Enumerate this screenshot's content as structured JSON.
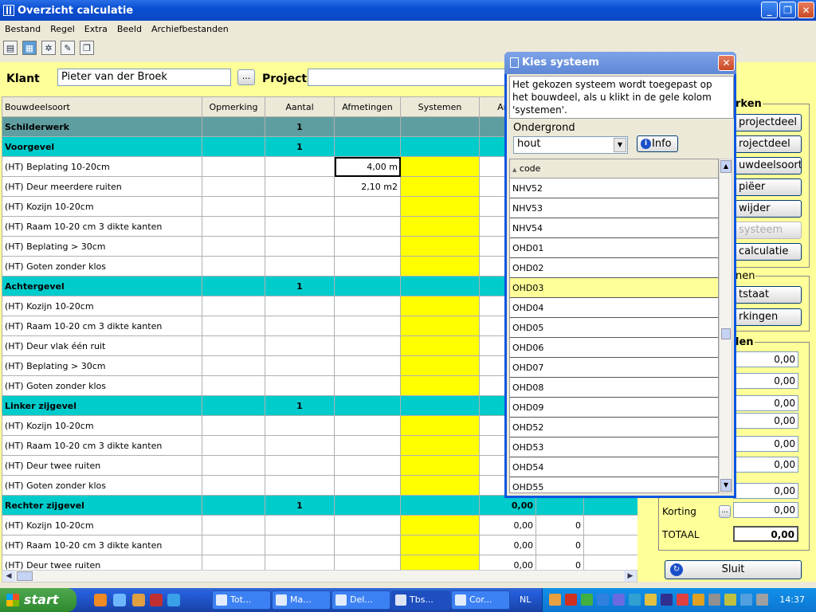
{
  "window": {
    "title": "Overzicht calculatie"
  },
  "menu": [
    "Bestand",
    "Regel",
    "Extra",
    "Beeld",
    "Archiefbestanden"
  ],
  "header": {
    "klant_label": "Klant",
    "klant_value": "Pieter van der Broek",
    "dots": "...",
    "project_label": "Project",
    "project_value": ""
  },
  "grid": {
    "columns": [
      "Bouwdeelsoort",
      "Opmerking",
      "Aantal",
      "Afmetingen",
      "Systemen",
      "Arbe"
    ],
    "rows": [
      {
        "type": "sec-dark",
        "name": "Schilderwerk",
        "aantal": "1",
        "afm": "",
        "v1": "",
        "v2": ""
      },
      {
        "type": "sec",
        "name": "Voorgevel",
        "aantal": "1",
        "afm": "",
        "v1": "",
        "v2": ""
      },
      {
        "type": "item",
        "name": "(HT) Beplating 10-20cm",
        "aantal": "",
        "afm": "4,00 m",
        "v1": "",
        "v2": "",
        "sel": true
      },
      {
        "type": "item",
        "name": "(HT) Deur meerdere ruiten",
        "aantal": "",
        "afm": "2,10 m2",
        "v1": "",
        "v2": ""
      },
      {
        "type": "item",
        "name": "(HT) Kozijn 10-20cm",
        "aantal": "",
        "afm": "",
        "v1": "",
        "v2": ""
      },
      {
        "type": "item",
        "name": "(HT) Raam 10-20 cm 3 dikte kanten",
        "aantal": "",
        "afm": "",
        "v1": "",
        "v2": ""
      },
      {
        "type": "item",
        "name": "(HT) Beplating > 30cm",
        "aantal": "",
        "afm": "",
        "v1": "",
        "v2": ""
      },
      {
        "type": "item",
        "name": "(HT) Goten zonder klos",
        "aantal": "",
        "afm": "",
        "v1": "",
        "v2": ""
      },
      {
        "type": "sec",
        "name": "Achtergevel",
        "aantal": "1",
        "afm": "",
        "v1": "",
        "v2": ""
      },
      {
        "type": "item",
        "name": "(HT) Kozijn 10-20cm",
        "aantal": "",
        "afm": "",
        "v1": "",
        "v2": ""
      },
      {
        "type": "item",
        "name": "(HT) Raam 10-20 cm 3 dikte kanten",
        "aantal": "",
        "afm": "",
        "v1": "",
        "v2": ""
      },
      {
        "type": "item",
        "name": "(HT) Deur vlak één ruit",
        "aantal": "",
        "afm": "",
        "v1": "",
        "v2": ""
      },
      {
        "type": "item",
        "name": "(HT) Beplating > 30cm",
        "aantal": "",
        "afm": "",
        "v1": "",
        "v2": ""
      },
      {
        "type": "item",
        "name": "(HT) Goten zonder klos",
        "aantal": "",
        "afm": "",
        "v1": "",
        "v2": ""
      },
      {
        "type": "sec",
        "name": "Linker zijgevel",
        "aantal": "1",
        "afm": "",
        "v1": "",
        "v2": ""
      },
      {
        "type": "item",
        "name": "(HT) Kozijn 10-20cm",
        "aantal": "",
        "afm": "",
        "v1": "",
        "v2": ""
      },
      {
        "type": "item",
        "name": "(HT) Raam 10-20 cm 3 dikte kanten",
        "aantal": "",
        "afm": "",
        "v1": "",
        "v2": ""
      },
      {
        "type": "item",
        "name": "(HT) Deur twee ruiten",
        "aantal": "",
        "afm": "",
        "v1": "",
        "v2": ""
      },
      {
        "type": "item",
        "name": "(HT) Goten zonder klos",
        "aantal": "",
        "afm": "",
        "v1": "",
        "v2": ""
      },
      {
        "type": "sec",
        "name": "Rechter zijgevel",
        "aantal": "1",
        "afm": "",
        "v1": "0,00",
        "v2": ""
      },
      {
        "type": "item",
        "name": "(HT) Kozijn 10-20cm",
        "aantal": "",
        "afm": "",
        "v1": "0,00",
        "v2": "0"
      },
      {
        "type": "item",
        "name": "(HT) Raam 10-20 cm 3 dikte kanten",
        "aantal": "",
        "afm": "",
        "v1": "0,00",
        "v2": "0"
      },
      {
        "type": "item",
        "name": "(HT) Deur twee ruiten",
        "aantal": "",
        "afm": "",
        "v1": "0,00",
        "v2": "0"
      }
    ]
  },
  "right": {
    "sec1": "rken",
    "btn1": "projectdeel",
    "btn2": "rojectdeel",
    "btn3": "uwdeelsoort",
    "btn4": "piëer",
    "btn5": "wijder",
    "btn6": "systeem",
    "btn7": "calculatie",
    "sec2": "nen",
    "btn8": "tstaat",
    "btn9": "rkingen",
    "sec3": "len",
    "values": [
      "0,00",
      "0,00",
      "0,00",
      "0,00",
      "0,00",
      "0,00",
      "0,00"
    ],
    "korting_label": "Korting",
    "korting_value": "0,00",
    "totaal_label": "TOTAAL",
    "totaal_value": "0,00",
    "sluit": "Sluit"
  },
  "dialog": {
    "title": "Kies systeem",
    "description": "Het gekozen systeem wordt toegepast op het bouwdeel, als u klikt in de gele kolom 'systemen'.",
    "ondergrond_label": "Ondergrond",
    "ondergrond_value": "hout",
    "info": "Info",
    "list_header": "code",
    "items": [
      "NHV52",
      "NHV53",
      "NHV54",
      "OHD01",
      "OHD02",
      "OHD03",
      "OHD04",
      "OHD05",
      "OHD06",
      "OHD07",
      "OHD08",
      "OHD09",
      "OHD52",
      "OHD53",
      "OHD54",
      "OHD55"
    ],
    "selected": "OHD03"
  },
  "taskbar": {
    "start": "start",
    "tasks": [
      "Tot...",
      "Ma...",
      "Del...",
      "Tbs...",
      "Cor..."
    ],
    "lang": "NL",
    "time": "14:37"
  },
  "colors": {
    "background": "#ffff99",
    "section": "#00cccc",
    "section_dark": "#5f9ea0",
    "systemen": "#ffff00"
  }
}
